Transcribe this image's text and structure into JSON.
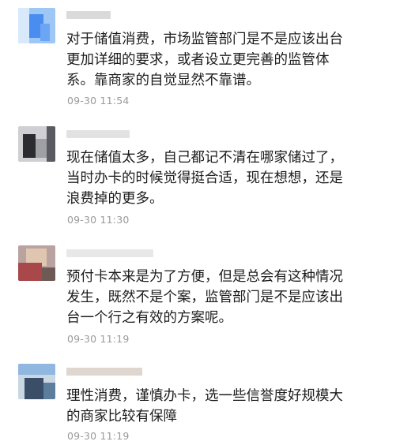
{
  "comments": [
    {
      "text": "对于储值消费，市场监管部门是不是应该出台\n更加详细的要求，或者设立更完善的监管体\n系。靠商家的自觉显然不靠谱。",
      "time": "09-30 11:54",
      "avatar_colors": [
        "#9ec7f5",
        "#4a8df0",
        "#d8e9fb",
        "#6aa6f3"
      ],
      "name_color": "#d3d3d3"
    },
    {
      "text": "现在储值太多，自己都记不清在哪家储过了，\n当时办卡的时候觉得挺合适，现在想想，还是\n浪费掉的更多。",
      "time": "09-30 11:30",
      "avatar_colors": [
        "#2b2b30",
        "#9f9fa6",
        "#cfcfd4",
        "#5a5a62"
      ],
      "name_color": "#dddddd"
    },
    {
      "text": "预付卡本来是为了方便，但是总会有这种情况\n发生，既然不是个案，监管部门是不是应该出\n台一个行之有效的方案呢。",
      "time": "09-30 11:19",
      "avatar_colors": [
        "#b9a3a0",
        "#a8484a",
        "#e0c6b0",
        "#6e5a55"
      ],
      "name_color": "#e4e4e4"
    },
    {
      "text": "理性消费，谨慎办卡，选一些信誉度好规模大\n的商家比较有保障",
      "time": "09-30 11:19",
      "avatar_colors": [
        "#8fb7e0",
        "#3a4f67",
        "#c9d7e3",
        "#5d7d9c"
      ],
      "name_color": "#d9cfc8"
    }
  ]
}
